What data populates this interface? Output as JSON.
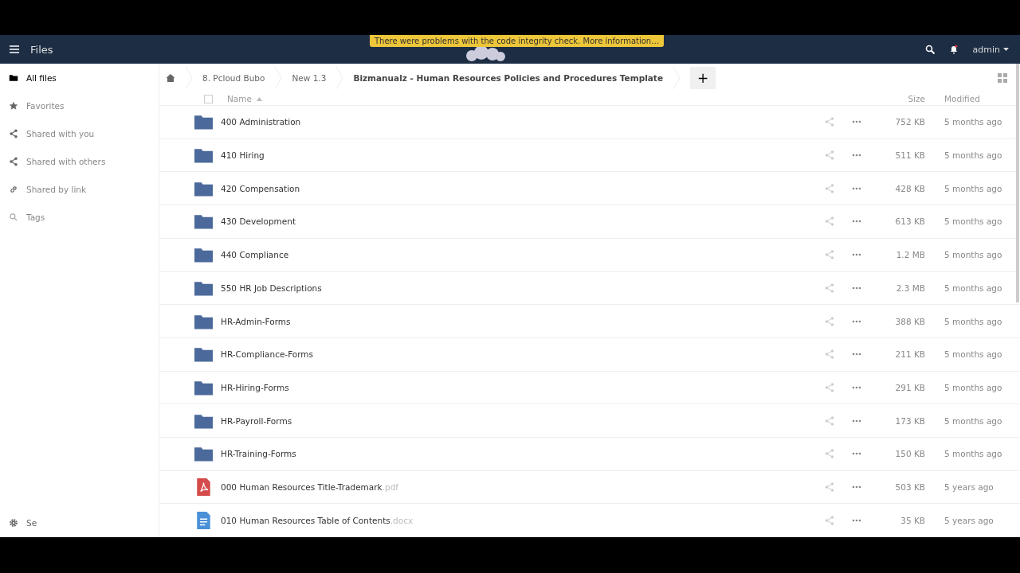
{
  "header": {
    "app_title": "Files",
    "warning": "There were problems with the code integrity check. More information…",
    "user": "admin"
  },
  "sidebar": {
    "items": [
      {
        "label": "All files",
        "selected": true
      },
      {
        "label": "Favorites",
        "selected": false
      },
      {
        "label": "Shared with you",
        "selected": false
      },
      {
        "label": "Shared with others",
        "selected": false
      },
      {
        "label": "Shared by link",
        "selected": false
      },
      {
        "label": "Tags",
        "selected": false
      }
    ],
    "settings": "Se"
  },
  "breadcrumbs": [
    "8. Pcloud Bubo",
    "New 1.3",
    "Bizmanualz - Human Resources Policies and Procedures Template"
  ],
  "new_button": "+",
  "table": {
    "select_all_checked": false,
    "columns": [
      "Name",
      "Size",
      "Modified"
    ],
    "rows": [
      {
        "kind": "folder",
        "name": "400 Administration",
        "size": "752 KB",
        "modified": "5 months ago"
      },
      {
        "kind": "folder",
        "name": "410 Hiring",
        "size": "511 KB",
        "modified": "5 months ago"
      },
      {
        "kind": "folder",
        "name": "420 Compensation",
        "size": "428 KB",
        "modified": "5 months ago"
      },
      {
        "kind": "folder",
        "name": "430 Development",
        "size": "613 KB",
        "modified": "5 months ago"
      },
      {
        "kind": "folder",
        "name": "440 Compliance",
        "size": "1.2 MB",
        "modified": "5 months ago"
      },
      {
        "kind": "folder",
        "name": "550 HR Job Descriptions",
        "size": "2.3 MB",
        "modified": "5 months ago"
      },
      {
        "kind": "folder",
        "name": "HR-Admin-Forms",
        "size": "388 KB",
        "modified": "5 months ago"
      },
      {
        "kind": "folder",
        "name": "HR-Compliance-Forms",
        "size": "211 KB",
        "modified": "5 months ago"
      },
      {
        "kind": "folder",
        "name": "HR-Hiring-Forms",
        "size": "291 KB",
        "modified": "5 months ago"
      },
      {
        "kind": "folder",
        "name": "HR-Payroll-Forms",
        "size": "173 KB",
        "modified": "5 months ago"
      },
      {
        "kind": "folder",
        "name": "HR-Training-Forms",
        "size": "150 KB",
        "modified": "5 months ago"
      },
      {
        "kind": "pdf",
        "name": "000 Human Resources Title-Trademark",
        "extension": ".pdf",
        "size": "503 KB",
        "modified": "5 years ago"
      },
      {
        "kind": "document",
        "name": "010 Human Resources Table of Contents",
        "extension": ".docx",
        "size": "35 KB",
        "modified": "5 years ago"
      }
    ]
  }
}
